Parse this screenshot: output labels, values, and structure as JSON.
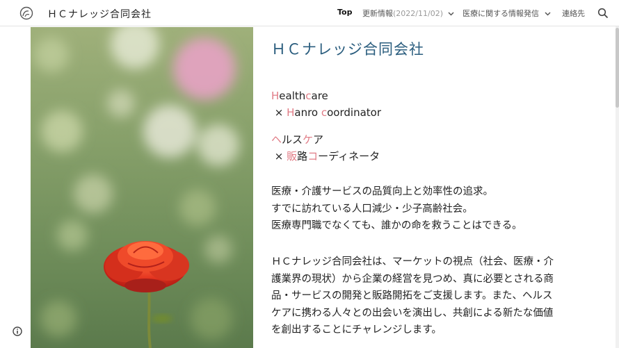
{
  "header": {
    "site_title": "ＨＣナレッジ合同会社",
    "nav": [
      {
        "label": "Top"
      },
      {
        "label": "更新情報",
        "sub": "(2022/11/02)"
      },
      {
        "label": "医療に関する情報発信"
      },
      {
        "label": "連絡先"
      }
    ]
  },
  "main": {
    "heading": "ＨＣナレッジ合同会社",
    "tagline_en": {
      "l1_a": "H",
      "l1_b": "ealth",
      "l1_c": "c",
      "l1_d": "are",
      "l2_a": " × ",
      "l2_b": "H",
      "l2_c": "anro ",
      "l2_d": "c",
      "l2_e": "oordinator"
    },
    "tagline_ja": {
      "l1_a": "ヘ",
      "l1_b": "ルス",
      "l1_c": "ケ",
      "l1_d": "ア",
      "l2_a": " × ",
      "l2_b": "販",
      "l2_c": "路",
      "l2_d": "コ",
      "l2_e": "ーディネータ"
    },
    "paragraph1": [
      "医療・介護サービスの品質向上と効率性の追求。",
      "すでに訪れている人口減少・少子高齢社会。",
      "医療専門職でなくても、誰かの命を救うことはできる。"
    ],
    "paragraph2": [
      "ＨＣナレッジ合同会社は、マーケットの視点（社会、医療・介",
      "護業界の現状）から企業の経営を見つめ、真に必要とされる商",
      "品・サービスの開発と販路開拓をご支援します。また、ヘルス",
      "ケアに携わる人々との出会いを演出し、共創による新たな価値",
      "を創出することにチャレンジします。"
    ]
  },
  "colors": {
    "accent_heading": "#2a5d7e",
    "highlight": "#e07b85"
  },
  "icons": [
    "logo-icon",
    "chevron-down-icon",
    "search-icon",
    "info-icon"
  ]
}
